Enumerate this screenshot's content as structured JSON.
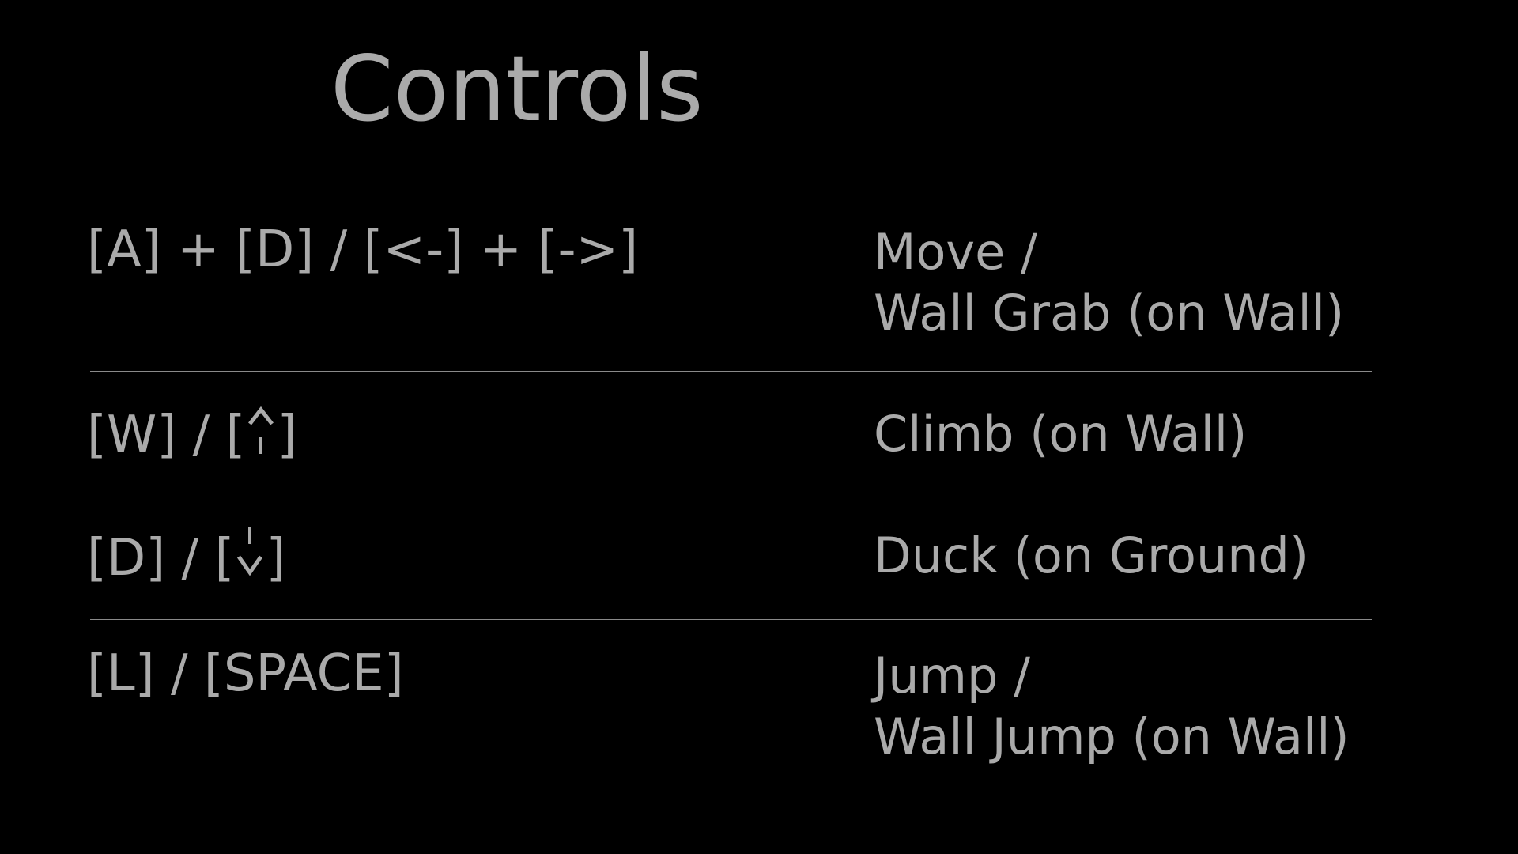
{
  "title": "Controls",
  "rows": [
    {
      "keys": [
        "[A] + [D] / [<-] + [->]"
      ],
      "action": [
        "Move /",
        "Wall Grab (on Wall)"
      ]
    },
    {
      "keys_prefix": "[W] / [",
      "keys_icon": "up-arrow-icon",
      "keys_suffix": "]",
      "action": [
        "Climb (on Wall)"
      ]
    },
    {
      "keys_prefix": "[D] / [",
      "keys_icon": "down-arrow-icon",
      "keys_suffix": "]",
      "action": [
        "Duck (on Ground)"
      ]
    },
    {
      "keys": [
        "[L] / [SPACE]"
      ],
      "action": [
        "Jump /",
        "Wall Jump (on Wall)"
      ]
    }
  ],
  "colors": {
    "background": "#000000",
    "text": "#aaaaaa",
    "divider": "#8a8a8a"
  }
}
